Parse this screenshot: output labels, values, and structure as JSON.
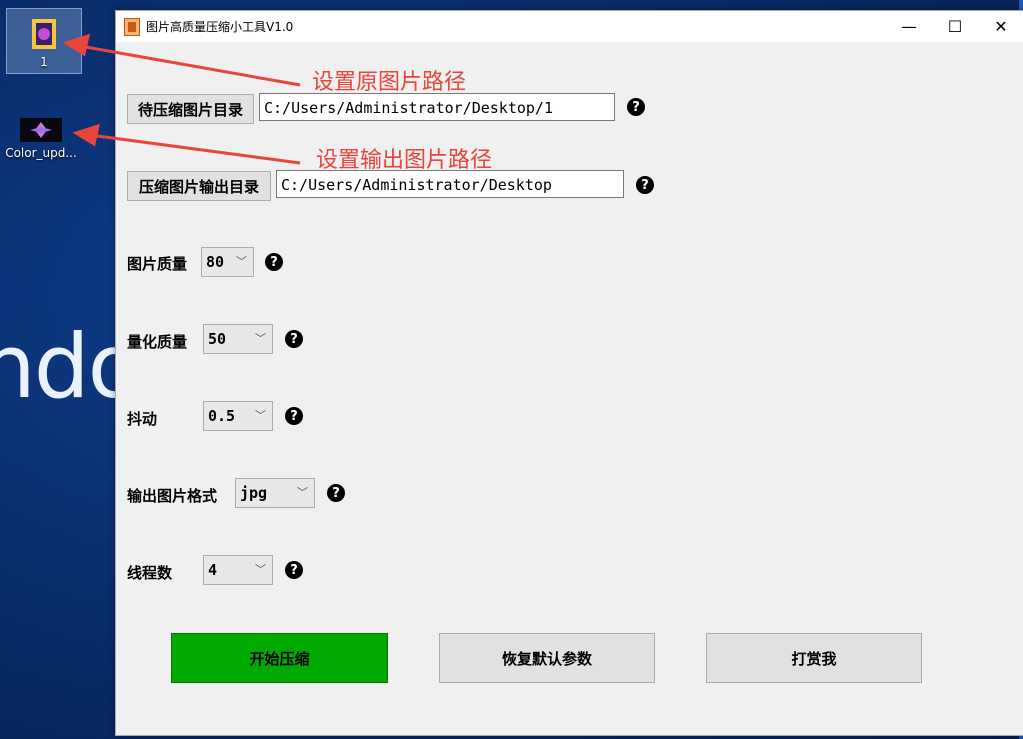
{
  "desktop": {
    "icons": [
      {
        "label": "1"
      },
      {
        "label": "Color_upd..."
      }
    ],
    "bg_text": "ndo"
  },
  "window": {
    "title": "图片高质量压缩小工具V1.0",
    "controls": {
      "minimize": "—",
      "maximize": "☐",
      "close": "✕"
    }
  },
  "form": {
    "source_dir": {
      "button": "待压缩图片目录",
      "value": "C:/Users/Administrator/Desktop/1"
    },
    "output_dir": {
      "button": "压缩图片输出目录",
      "value": "C:/Users/Administrator/Desktop"
    },
    "image_quality": {
      "label": "图片质量",
      "value": "80"
    },
    "quantize_quality": {
      "label": "量化质量",
      "value": "50"
    },
    "dither": {
      "label": "抖动",
      "value": "0.5"
    },
    "output_format": {
      "label": "输出图片格式",
      "value": "jpg"
    },
    "threads": {
      "label": "线程数",
      "value": "4"
    },
    "help_glyph": "?"
  },
  "actions": {
    "start": "开始压缩",
    "reset": "恢复默认参数",
    "reward": "打赏我"
  },
  "annotations": {
    "source_note": "设置原图片路径",
    "output_note": "设置输出图片路径",
    "color": "#e8453c"
  },
  "colors": {
    "start_button": "#00aa00",
    "accent_annotation": "#e8453c"
  }
}
